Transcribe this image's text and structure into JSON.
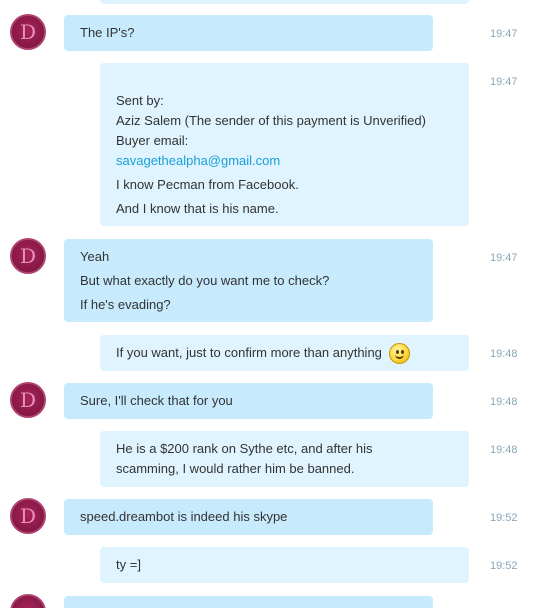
{
  "messages": [
    {
      "id": "m1",
      "lines": [
        "The IP's?"
      ],
      "time": "19:47"
    },
    {
      "id": "m2",
      "lines": [
        "Sent by:",
        "Aziz Salem (The sender of this payment is Unverified)",
        "Buyer email:",
        "savagethealpha@gmail.com",
        "I know Pecman from Facebook.",
        "And I know that is his name."
      ],
      "time": "19:47"
    },
    {
      "id": "m3",
      "lines": [
        "Yeah",
        "But what exactly do you want me to check?",
        "If he's evading?"
      ],
      "time": "19:47"
    },
    {
      "id": "m4",
      "lines": [
        "If you want, just to confirm more than anything"
      ],
      "emoticon": "smiley-emoticon-icon",
      "time": "19:48"
    },
    {
      "id": "m5",
      "lines": [
        "Sure, I'll check that for you"
      ],
      "time": "19:48"
    },
    {
      "id": "m6",
      "lines": [
        "He is a $200 rank on Sythe etc, and after his",
        "scamming, I would rather him be banned."
      ],
      "time": "19:48"
    },
    {
      "id": "m7",
      "lines": [
        "speed.dreambot is indeed his skype"
      ],
      "time": "19:52"
    },
    {
      "id": "m8",
      "lines": [
        "ty =]"
      ],
      "time": "19:52"
    }
  ],
  "avatar_letter": "D",
  "colors": {
    "incoming_bubble": "#c7eafd",
    "outgoing_bubble": "#dff4fe",
    "link": "#1a9ed9",
    "timestamp": "#8aa6b8",
    "avatar": "#8a1a48"
  }
}
